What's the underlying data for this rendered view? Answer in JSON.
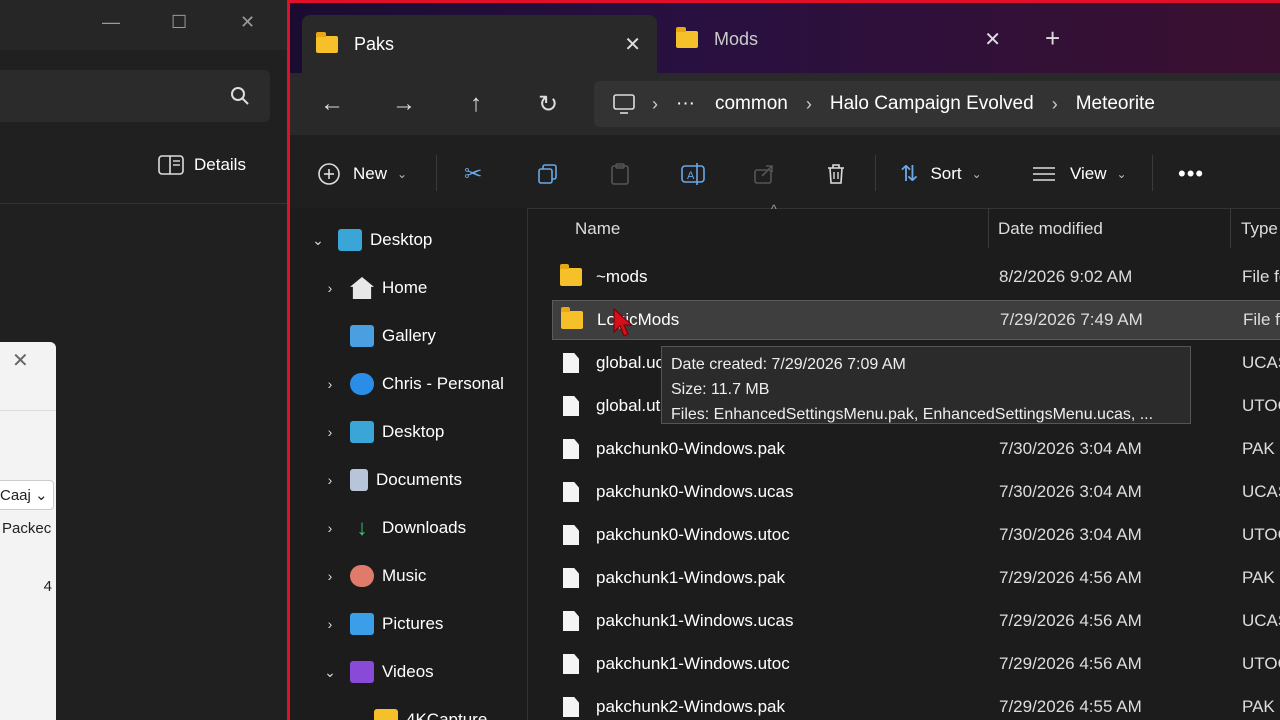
{
  "background_window": {
    "details_label": "Details",
    "dialog": {
      "select_text": "Caaj",
      "packed_text": "Packec",
      "number": "4"
    }
  },
  "tabs": [
    {
      "label": "Paks",
      "active": true
    },
    {
      "label": "Mods",
      "active": false
    }
  ],
  "breadcrumb": [
    "common",
    "Halo Campaign Evolved",
    "Meteorite"
  ],
  "toolbar": {
    "new_label": "New",
    "sort_label": "Sort",
    "view_label": "View"
  },
  "nav": [
    {
      "label": "Desktop",
      "icon": "desktop-icon",
      "expanded": true
    },
    {
      "label": "Home",
      "icon": "home-icon"
    },
    {
      "label": "Gallery",
      "icon": "gallery-icon"
    },
    {
      "label": "Chris - Personal",
      "icon": "onedrive-icon"
    },
    {
      "label": "Desktop",
      "icon": "desktop-icon"
    },
    {
      "label": "Documents",
      "icon": "documents-icon"
    },
    {
      "label": "Downloads",
      "icon": "downloads-icon"
    },
    {
      "label": "Music",
      "icon": "music-icon"
    },
    {
      "label": "Pictures",
      "icon": "pictures-icon"
    },
    {
      "label": "Videos",
      "icon": "videos-icon",
      "expanded": true
    },
    {
      "label": "4KCapture",
      "icon": "folder-icon"
    }
  ],
  "columns": {
    "name": "Name",
    "date": "Date modified",
    "type": "Type"
  },
  "files": [
    {
      "name": "~mods",
      "date": "8/2/2026 9:02 AM",
      "type": "File fo",
      "kind": "folder"
    },
    {
      "name": "LogicMods",
      "date": "7/29/2026 7:49 AM",
      "type": "File fo",
      "kind": "folder",
      "selected": true
    },
    {
      "name": "global.ucas",
      "date": "",
      "type": "UCAS",
      "kind": "file"
    },
    {
      "name": "global.utoc",
      "date": "",
      "type": "UTOC",
      "kind": "file"
    },
    {
      "name": "pakchunk0-Windows.pak",
      "date": "7/30/2026 3:04 AM",
      "type": "PAK F",
      "kind": "file"
    },
    {
      "name": "pakchunk0-Windows.ucas",
      "date": "7/30/2026 3:04 AM",
      "type": "UCAS",
      "kind": "file"
    },
    {
      "name": "pakchunk0-Windows.utoc",
      "date": "7/30/2026 3:04 AM",
      "type": "UTOC",
      "kind": "file"
    },
    {
      "name": "pakchunk1-Windows.pak",
      "date": "7/29/2026 4:56 AM",
      "type": "PAK F",
      "kind": "file"
    },
    {
      "name": "pakchunk1-Windows.ucas",
      "date": "7/29/2026 4:56 AM",
      "type": "UCAS",
      "kind": "file"
    },
    {
      "name": "pakchunk1-Windows.utoc",
      "date": "7/29/2026 4:56 AM",
      "type": "UTOC",
      "kind": "file"
    },
    {
      "name": "pakchunk2-Windows.pak",
      "date": "7/29/2026 4:55 AM",
      "type": "PAK F",
      "kind": "file"
    }
  ],
  "tooltip": {
    "line1": "Date created: 7/29/2026 7:09 AM",
    "line2": "Size: 11.7 MB",
    "line3": "Files: EnhancedSettingsMenu.pak, EnhancedSettingsMenu.ucas, ..."
  },
  "colors": {
    "accent_border": "#e0102a",
    "folder": "#f5c02a"
  }
}
